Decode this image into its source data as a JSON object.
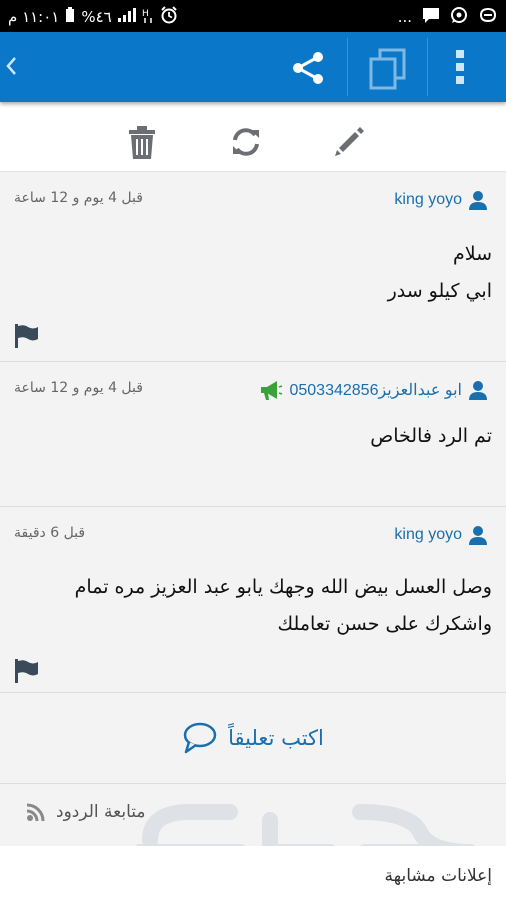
{
  "status_bar": {
    "time": "١١:٠١ م",
    "battery": "%٤٦",
    "notification_count": "..."
  },
  "app_bar": {
    "back_icon": "chevron-left-icon",
    "share_icon": "share-icon",
    "copy_icon": "copy-icon",
    "more_icon": "more-vert-icon"
  },
  "toolbar": {
    "delete_icon": "trash-icon",
    "refresh_icon": "refresh-icon",
    "edit_icon": "pencil-icon"
  },
  "comments": [
    {
      "author": "king yoyo",
      "time": "قبل 4 يوم و 12 ساعة",
      "lines": [
        "سلام",
        "ابي كيلو سدر"
      ],
      "flag": true,
      "seller_badge": false
    },
    {
      "author": "ابو عبدالعزيز0503342856",
      "time": "قبل 4 يوم و 12 ساعة",
      "lines": [
        "تم الرد فالخاص"
      ],
      "flag": false,
      "seller_badge": true
    },
    {
      "author": "king yoyo",
      "time": "قبل 6 دقيقة",
      "lines": [
        "وصل العسل بيض الله وجهك يابو عبد العزيز مره تمام",
        "واشكرك على حسن تعاملك"
      ],
      "flag": true,
      "seller_badge": false
    }
  ],
  "write_comment": {
    "label": "اكتب تعليقاً"
  },
  "follow_replies": {
    "label": "متابعة الردود"
  },
  "similar_ads": {
    "label": "إعلانات مشابهة"
  },
  "colors": {
    "brand": "#0a77c9",
    "link": "#1a6fae",
    "seller_badge": "#3aa23a"
  }
}
